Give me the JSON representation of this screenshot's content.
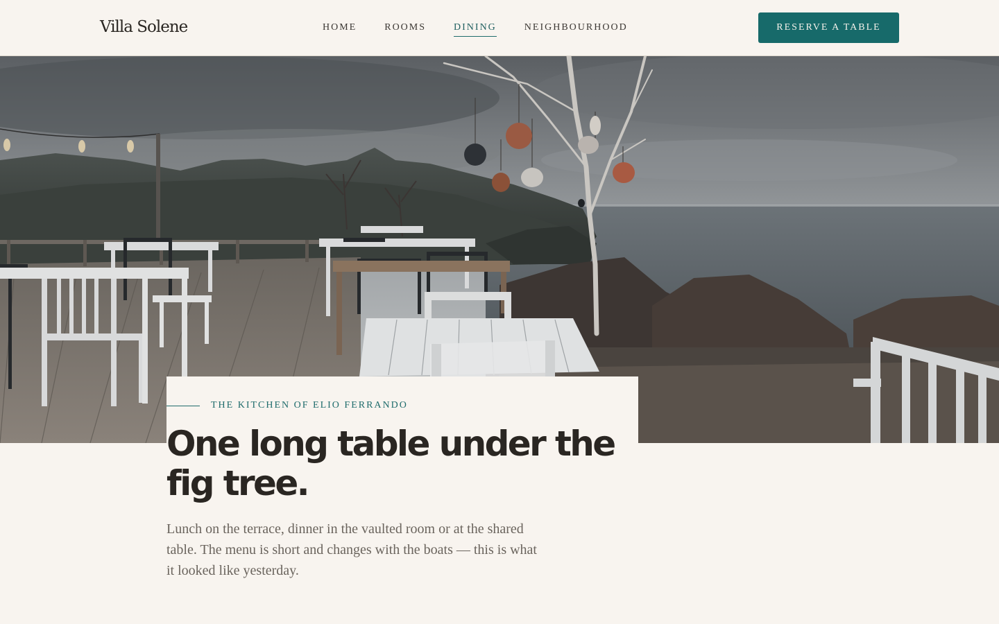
{
  "header": {
    "brand": "Villa Solene",
    "nav": [
      {
        "label": "HOME",
        "active": false
      },
      {
        "label": "ROOMS",
        "active": false
      },
      {
        "label": "DINING",
        "active": true
      },
      {
        "label": "NEIGHBOURHOOD",
        "active": false
      }
    ],
    "cta_label": "RESERVE A TABLE"
  },
  "intro": {
    "eyebrow": "THE KITCHEN OF ELIO FERRANDO",
    "headline": "One long table under the fig tree.",
    "lede": "Lunch on the terrace, dinner in the vaulted room or at the shared table. The menu is short and changes with the boats — this is what it looked like yesterday."
  },
  "colors": {
    "accent": "#176a6a",
    "background": "#f8f4ef",
    "text": "#2a2622",
    "muted_text": "#6a645d"
  }
}
